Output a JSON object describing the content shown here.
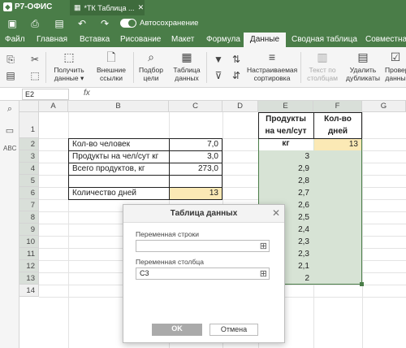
{
  "app": {
    "logo": "Р7-ОФИС",
    "doc_tab": "*ТК Таблица ...",
    "autosave_label": "Автосохранение"
  },
  "menu": {
    "tabs": [
      "Файл",
      "Главная",
      "Вставка",
      "Рисование",
      "Макет",
      "Формула",
      "Данные",
      "Сводная таблица",
      "Совместная"
    ],
    "active": "Данные"
  },
  "ribbon": {
    "get_data": "Получить данные ▾",
    "external_links": "Внешние ссылки",
    "goal_seek": "Подбор цели",
    "data_table": "Таблица данных",
    "custom_sort": "Настраиваемая сортировка",
    "text_to_columns": "Текст по столбцам",
    "remove_duplicates": "Удалить дубликаты",
    "data_validation": "Провер данны"
  },
  "formula_bar": {
    "cell_ref": "E2",
    "fx": "fx",
    "value": ""
  },
  "grid": {
    "columns": [
      "A",
      "B",
      "C",
      "D",
      "E",
      "F",
      "G"
    ],
    "rows": [
      "1",
      "2",
      "3",
      "4",
      "5",
      "6",
      "7",
      "8",
      "9",
      "10",
      "11",
      "12",
      "13",
      "14"
    ],
    "cells": {
      "B2": "Кол-во человек",
      "C2": "7,0",
      "B3": "Продукты на чел/сут кг",
      "C3": "3,0",
      "B4": "Всего продуктов, кг",
      "C4": "273,0",
      "B6": "Количество дней",
      "C6": "13",
      "E1": "Продукты на чел/сут кг",
      "F1": "Кол-во дней",
      "F2": "13",
      "E3": "3",
      "E4": "2,9",
      "E5": "2,8",
      "E6": "2,7",
      "E7": "2,6",
      "E8": "2,5",
      "E9": "2,4",
      "E10": "2,3",
      "E11": "2,3",
      "E12": "2,1",
      "E13": "2"
    }
  },
  "dialog": {
    "title": "Таблица данных",
    "row_input_label": "Переменная строки",
    "row_input_value": "",
    "col_input_label": "Переменная столбца",
    "col_input_value": "C3",
    "ok_label": "OK",
    "cancel_label": "Отмена"
  },
  "colors": {
    "brand": "#4a7d48",
    "highlight_cell": "#fbe9b5",
    "range_fill": "#d7e3d5"
  }
}
